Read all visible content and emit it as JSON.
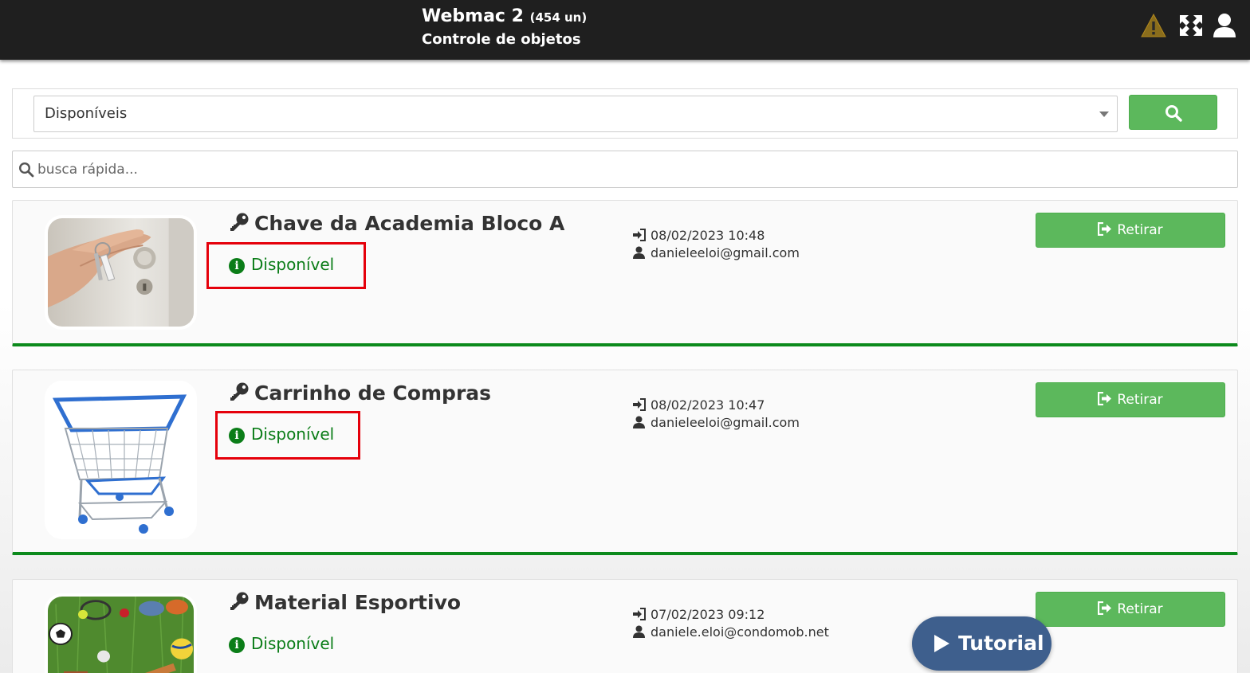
{
  "header": {
    "app_name": "Webmac 2",
    "count": "(454 un)",
    "subtitle": "Controle de objetos",
    "icons": [
      "warning-icon",
      "expand-icon",
      "user-icon"
    ]
  },
  "filter": {
    "selected": "Disponíveis",
    "search_icon": "search-icon"
  },
  "quick_search": {
    "placeholder": "busca rápida..."
  },
  "items": [
    {
      "title": "Chave da Academia Bloco A",
      "status": "Disponível",
      "date": "08/02/2023 10:48",
      "user": "danieleeloi@gmail.com",
      "action": "Retirar",
      "image": "keys-in-hand"
    },
    {
      "title": "Carrinho de Compras",
      "status": "Disponível",
      "date": "08/02/2023 10:47",
      "user": "danieleeloi@gmail.com",
      "action": "Retirar",
      "image": "shopping-cart"
    },
    {
      "title": "Material Esportivo",
      "status": "Disponível",
      "date": "07/02/2023 09:12",
      "user": "daniele.eloi@condomob.net",
      "action": "Retirar",
      "image": "sports-equipment"
    }
  ],
  "tutorial": {
    "label": "Tutorial"
  },
  "colors": {
    "header_bg": "#1f1f1f",
    "success_green": "#5cb85c",
    "status_green": "#0b7d18",
    "highlight_red": "#e5000b",
    "tutorial_blue": "#3e5f8d"
  }
}
